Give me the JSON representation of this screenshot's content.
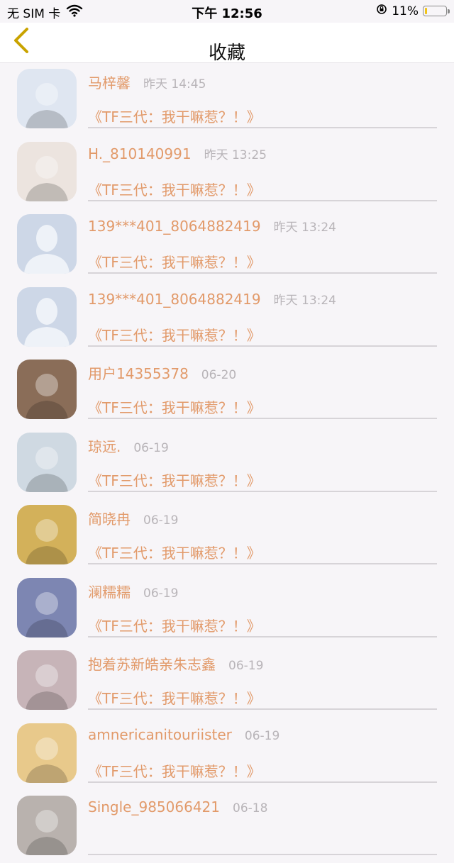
{
  "status_bar": {
    "carrier": "无 SIM 卡",
    "time": "下午 12:56",
    "battery_percent": "11%",
    "battery_level": 0.11,
    "wifi_icon": "wifi-icon",
    "lock_icon": "orientation-lock-icon"
  },
  "nav": {
    "title": "收藏",
    "back_icon": "chevron-left-icon",
    "back_color": "#c9a300"
  },
  "colors": {
    "accent": "#e29a6a",
    "muted": "#b8b4b8"
  },
  "items": [
    {
      "name": "马梓馨",
      "time": "昨天 14:45",
      "title": "《TF三代：我干嘛惹？！》",
      "avatar": "photo-avatar"
    },
    {
      "name": "H._810140991",
      "time": "昨天 13:25",
      "title": "《TF三代：我干嘛惹？！》",
      "avatar": "photo-avatar"
    },
    {
      "name": "139***401_8064882419",
      "time": "昨天 13:24",
      "title": "《TF三代：我干嘛惹？！》",
      "avatar": "default-user-avatar"
    },
    {
      "name": "139***401_8064882419",
      "time": "昨天 13:24",
      "title": "《TF三代：我干嘛惹？！》",
      "avatar": "default-user-avatar"
    },
    {
      "name": "用户14355378",
      "time": "06-20",
      "title": "《TF三代：我干嘛惹？！》",
      "avatar": "photo-avatar"
    },
    {
      "name": "琼远.",
      "time": "06-19",
      "title": "《TF三代：我干嘛惹？！》",
      "avatar": "photo-avatar"
    },
    {
      "name": "简晓冉",
      "time": "06-19",
      "title": "《TF三代：我干嘛惹？！》",
      "avatar": "photo-avatar"
    },
    {
      "name": "澜糯糯",
      "time": "06-19",
      "title": "《TF三代：我干嘛惹？！》",
      "avatar": "photo-avatar"
    },
    {
      "name": "抱着苏新皓亲朱志鑫",
      "time": "06-19",
      "title": "《TF三代：我干嘛惹？！》",
      "avatar": "photo-avatar"
    },
    {
      "name": "amnericanitouriister",
      "time": "06-19",
      "title": "《TF三代：我干嘛惹？！》",
      "avatar": "photo-avatar"
    },
    {
      "name": "Single_985066421",
      "time": "06-18",
      "title": "",
      "avatar": "photo-avatar"
    }
  ]
}
